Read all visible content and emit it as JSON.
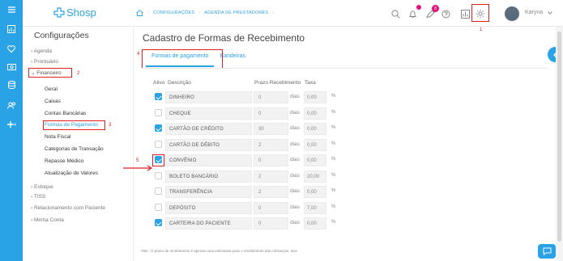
{
  "rail": {
    "icons": [
      "menu-icon",
      "dashboard-icon",
      "heart-icon",
      "money-icon",
      "database-icon",
      "users-icon",
      "add-icon"
    ]
  },
  "logo": {
    "text": "Shosp"
  },
  "breadcrumb": {
    "items": [
      "CONFIGURAÇÕES",
      "AGENDA DE PRESTADORES"
    ]
  },
  "topbar": {
    "notif_badge_1": "",
    "notif_badge_2": "8",
    "user_name": "Karyna"
  },
  "annotations": [
    "1",
    "2",
    "3",
    "4",
    "5"
  ],
  "left": {
    "title": "Configurações",
    "items": [
      "Agenda",
      "Prontuário",
      "Financeiro",
      "Estoque",
      "TISS",
      "Relacionamento com Paciente",
      "Minha Conta"
    ],
    "financeiro_sub": [
      "Geral",
      "Caixas",
      "Contas Bancárias",
      "Formas de Pagamento",
      "Nota Fiscal",
      "Categorias de Transação",
      "Repasse Médico",
      "Atualização de Valores"
    ]
  },
  "main": {
    "title": "Cadastro de Formas de Recebimento",
    "tabs": [
      "Formas de pagamento",
      "Bandeiras"
    ],
    "headers": {
      "ativo": "Ativo",
      "descricao": "Descrição",
      "prazo": "Prazo Recebimento",
      "taxa": "Taxa"
    },
    "dias_label": "dias",
    "pct_label": "%",
    "rows": [
      {
        "active": true,
        "desc": "DINHEIRO",
        "prazo": "0",
        "taxa": "0,00"
      },
      {
        "active": false,
        "desc": "CHEQUE",
        "prazo": "0",
        "taxa": "0,00"
      },
      {
        "active": true,
        "desc": "CARTÃO DE CRÉDITO",
        "prazo": "30",
        "taxa": "0,00"
      },
      {
        "active": false,
        "desc": "CARTÃO DE DÉBITO",
        "prazo": "2",
        "taxa": "0,00"
      },
      {
        "active": true,
        "desc": "CONVÊNIO",
        "prazo": "0",
        "taxa": "0,00"
      },
      {
        "active": false,
        "desc": "BOLETO BANCÁRIO",
        "prazo": "2",
        "taxa": "20,00"
      },
      {
        "active": false,
        "desc": "TRANSFERÊNCIA",
        "prazo": "2",
        "taxa": "0,00"
      },
      {
        "active": false,
        "desc": "DEPÓSITO",
        "prazo": "0",
        "taxa": "7,00"
      },
      {
        "active": true,
        "desc": "CARTEIRA DO PACIENTE",
        "prazo": "0",
        "taxa": "0,00"
      }
    ],
    "footnote": "Obs.: O prazo de recebimento é apenas uma estimativa para o recebimento das cobranças. Isso"
  },
  "colors": {
    "brand": "#2aa2e6",
    "annotation": "#e02020",
    "badge": "#e0137c"
  }
}
